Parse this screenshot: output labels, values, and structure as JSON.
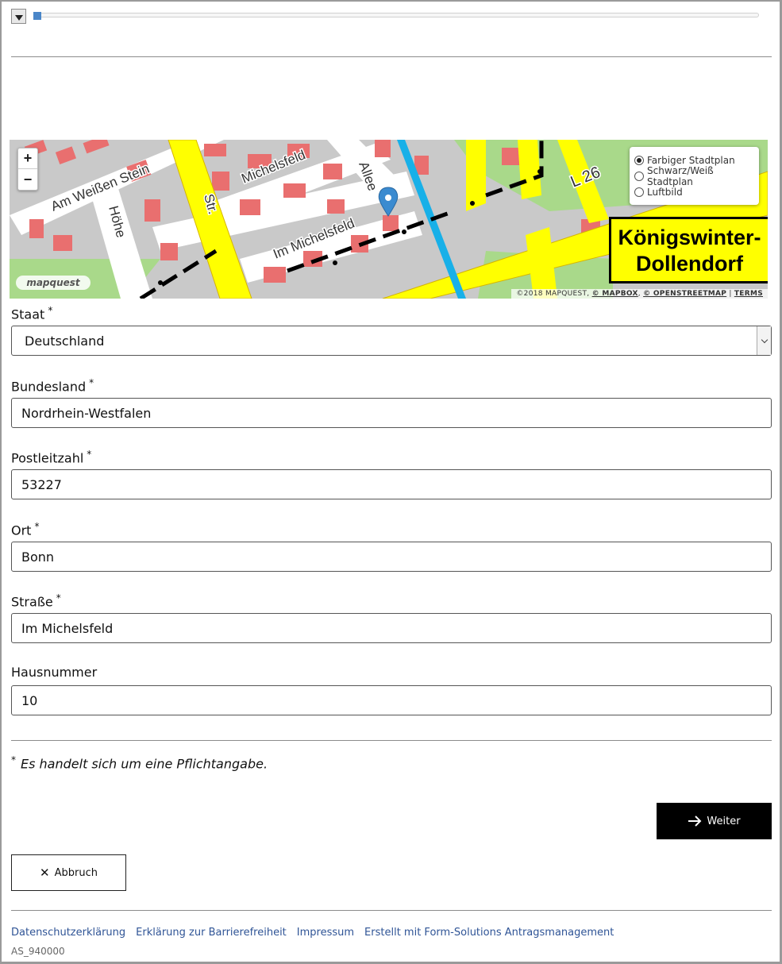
{
  "progress": {
    "toggle_icon": "chevron-down-icon",
    "value": 0.01
  },
  "map": {
    "zoom_in": "+",
    "zoom_out": "−",
    "layers": [
      {
        "label": "Farbiger Stadtplan",
        "selected": true
      },
      {
        "label": "Schwarz/Weiß Stadtplan",
        "selected": false
      },
      {
        "label": "Luftbild",
        "selected": false
      }
    ],
    "street_labels": [
      "Am Weißen Stein",
      "Michelsfeld",
      "Allee",
      "Im Michelsfeld",
      "L 26",
      "Str.",
      "Höhe"
    ],
    "city_sign_line1": "Königswinter-",
    "city_sign_line2": "Dollendorf",
    "logo": "mapquest",
    "attribution": {
      "copy": "©2018 MAPQUEST,",
      "mapbox": "© MAPBOX",
      "osm": "© OPENSTREETMAP",
      "terms": "TERMS"
    },
    "colors": {
      "buildings": "#e96f6f",
      "roads_major": "#ffff00",
      "water": "#18b0e8",
      "background": "#c9c9c9"
    }
  },
  "form": {
    "staat": {
      "label": "Staat",
      "required": "*",
      "value": "Deutschland"
    },
    "bundesland": {
      "label": "Bundesland",
      "required": "*",
      "value": "Nordrhein-Westfalen"
    },
    "plz": {
      "label": "Postleitzahl",
      "required": "*",
      "value": "53227"
    },
    "ort": {
      "label": "Ort",
      "required": "*",
      "value": "Bonn"
    },
    "strasse": {
      "label": "Straße",
      "required": "*",
      "value": "Im Michelsfeld"
    },
    "hausnummer": {
      "label": "Hausnummer",
      "value": "10"
    }
  },
  "note": {
    "star": "*",
    "text": "Es handelt sich um eine Pflichtangabe."
  },
  "buttons": {
    "next": "Weiter",
    "cancel": "Abbruch"
  },
  "footer": {
    "links": [
      "Datenschutzerklärung",
      "Erklärung zur Barrierefreiheit",
      "Impressum",
      "Erstellt mit Form-Solutions Antragsmanagement"
    ],
    "id": "AS_940000"
  }
}
